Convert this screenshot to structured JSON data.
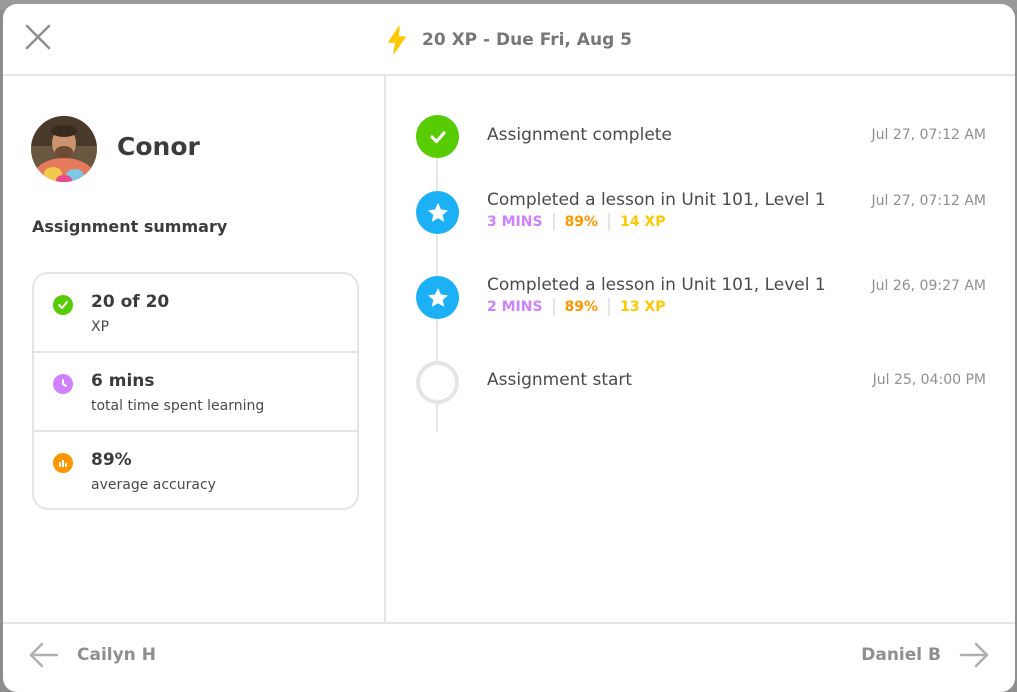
{
  "header": {
    "title": "20 XP - Due Fri, Aug 5",
    "icon": "lightning-bolt-icon",
    "icon_color": "#ffc800"
  },
  "student": {
    "name": "Conor"
  },
  "summary": {
    "heading": "Assignment summary",
    "stats": [
      {
        "value": "20 of 20",
        "label": "XP",
        "icon": "check-circle-icon",
        "color": "#58cc02"
      },
      {
        "value": "6 mins",
        "label": "total time spent learning",
        "icon": "clock-icon",
        "color": "#ce82ff"
      },
      {
        "value": "89%",
        "label": "average accuracy",
        "icon": "bar-chart-icon",
        "color": "#ff9600"
      }
    ]
  },
  "timeline": {
    "events": [
      {
        "title": "Assignment complete",
        "time": "Jul 27, 07:12 AM",
        "marker": "check-marker"
      },
      {
        "title": "Completed a lesson in Unit 101, Level 1",
        "time": "Jul 27, 07:12 AM",
        "marker": "star-marker",
        "mins": "3 MINS",
        "accuracy": "89%",
        "xp": "14 XP"
      },
      {
        "title": "Completed a lesson in Unit 101, Level 1",
        "time": "Jul 26, 09:27 AM",
        "marker": "star-marker",
        "mins": "2 MINS",
        "accuracy": "89%",
        "xp": "13 XP"
      },
      {
        "title": "Assignment start",
        "time": "Jul 25, 04:00 PM",
        "marker": "empty-marker"
      }
    ]
  },
  "footer": {
    "prev_label": "Cailyn H",
    "next_label": "Daniel B"
  },
  "colors": {
    "green": "#58cc02",
    "blue": "#1cb0f6",
    "purple": "#ce82ff",
    "orange": "#ff9600",
    "yellow": "#ffc800"
  }
}
